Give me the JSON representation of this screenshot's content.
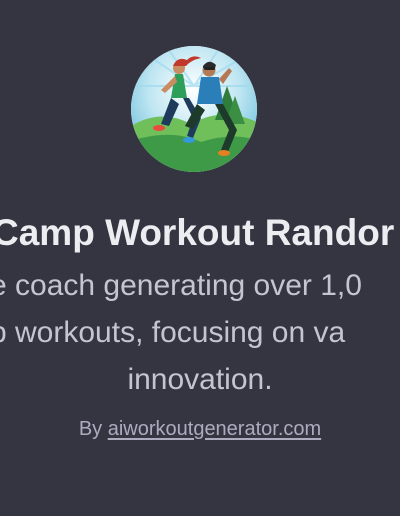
{
  "gpt": {
    "title": "Camp Workout Randor",
    "description_lines": [
      "e coach generating over 1,0",
      "p workouts, focusing on va",
      "innovation."
    ],
    "byline_prefix": "By",
    "byline_link": "aiworkoutgenerator.com",
    "avatar_icon": "workout-couple-illustration"
  },
  "colors": {
    "background": "#343541",
    "title": "#ececf1",
    "description": "#c5c5d2",
    "byline": "#acacbe"
  }
}
